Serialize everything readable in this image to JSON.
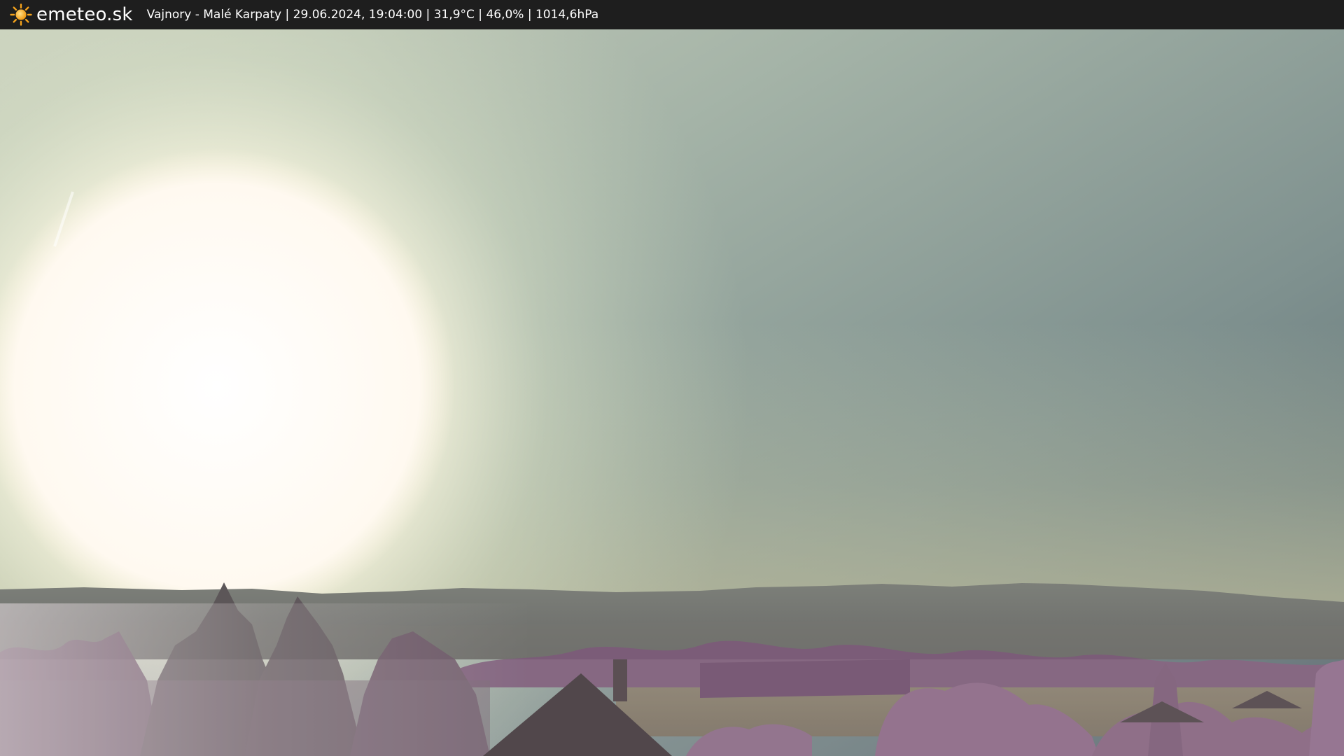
{
  "header": {
    "brand": "emeteo.sk",
    "logo_icon": "sun-icon",
    "caption": "Vajnory - Malé Karpaty | 29.06.2024, 19:04:00 | 31,9°C | 46,0% | 1014,6hPa"
  },
  "colors": {
    "bar_background": "#1e1e1e",
    "sun_orange": "#f6a31b",
    "sky_top_right": "#5a6d72",
    "sky_horizon": "#b9bd9f",
    "foliage": "#8a6a86"
  }
}
